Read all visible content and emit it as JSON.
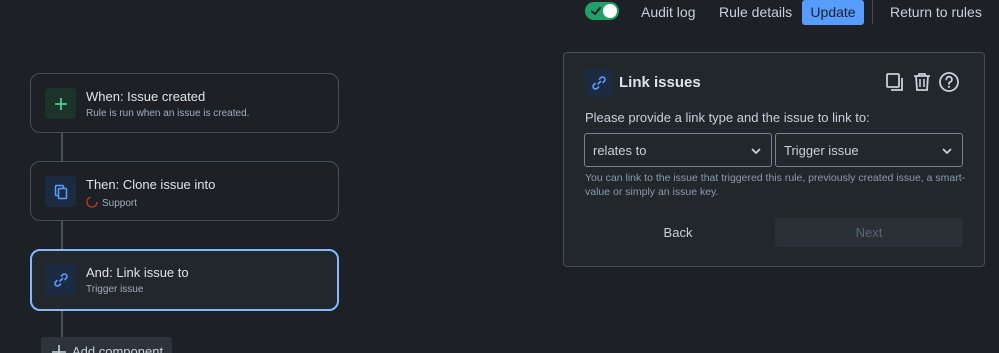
{
  "topbar": {
    "toggle_on": true,
    "audit_log": "Audit log",
    "rule_details": "Rule details",
    "update": "Update",
    "return_to_rules": "Return to rules"
  },
  "flow": {
    "steps": [
      {
        "title": "When: Issue created",
        "subtitle": "Rule is run when an issue is created.",
        "icon": "plus-icon"
      },
      {
        "title": "Then: Clone issue into",
        "subtitle": "Support",
        "icon": "copy-icon"
      },
      {
        "title": "And: Link issue to",
        "subtitle": "Trigger issue",
        "icon": "link-icon",
        "selected": true
      }
    ],
    "add_component": "Add component"
  },
  "panel": {
    "title": "Link issues",
    "prompt": "Please provide a link type and the issue to link to:",
    "link_type": {
      "value": "relates to"
    },
    "issue": {
      "value": "Trigger issue"
    },
    "help_text": "You can link to the issue that triggered this rule, previously created issue, a smart-value or simply an issue key.",
    "back": "Back",
    "next": "Next"
  },
  "colors": {
    "background": "#1d2125",
    "accent": "#579dff",
    "toggle": "#22a06b",
    "selected_border": "#85b8ff"
  }
}
